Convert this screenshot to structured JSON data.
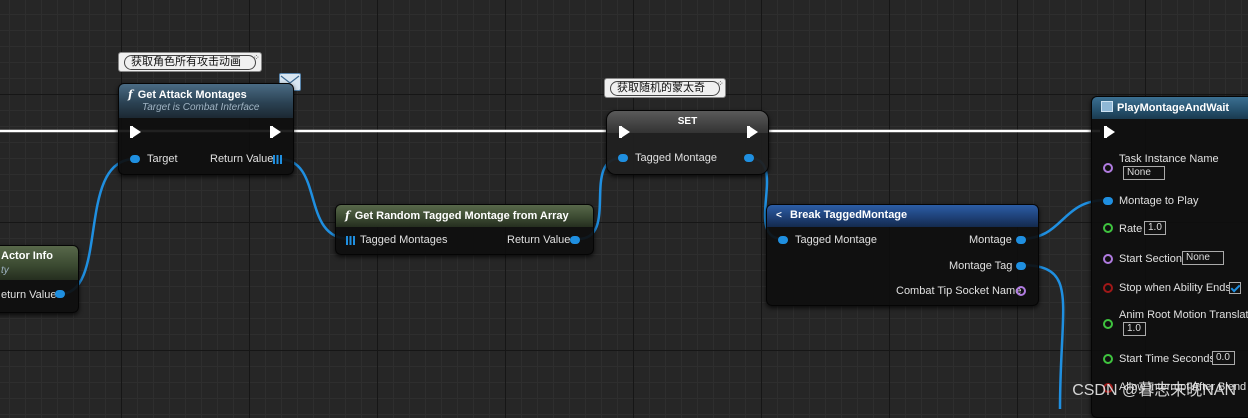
{
  "comments": {
    "get_attack": "获取角色所有攻击动画",
    "random": "获取随机的蒙太奇"
  },
  "nodes": {
    "actor_info": {
      "title": "Actor Info",
      "subtitle": "ty",
      "return_label": "eturn Value"
    },
    "get_attack": {
      "title": "Get Attack Montages",
      "subtitle": "Target is Combat Interface",
      "target_label": "Target",
      "return_label": "Return Value",
      "icon": "function-icon"
    },
    "random": {
      "title": "Get Random Tagged Montage from Array",
      "input_label": "Tagged Montages",
      "return_label": "Return Value",
      "icon": "function-icon"
    },
    "set": {
      "title": "SET",
      "pin_label": "Tagged Montage"
    },
    "break": {
      "title": "Break TaggedMontage",
      "input_label": "Tagged Montage",
      "out_montage": "Montage",
      "out_tag": "Montage Tag",
      "out_socket": "Combat Tip Socket Name",
      "icon": "break-struct-icon"
    },
    "play": {
      "title": "PlayMontageAndWait",
      "icon": "task-node-icon",
      "pins": {
        "task_instance_name": "Task Instance Name",
        "task_instance_value": "None",
        "montage_to_play": "Montage to Play",
        "rate": "Rate",
        "rate_value": "1.0",
        "start_section": "Start Section",
        "start_section_value": "None",
        "stop_when_ability_ends": "Stop when Ability Ends",
        "stop_when_ability_ends_checked": true,
        "anim_root_motion": "Anim Root Motion Translatio",
        "anim_root_motion_value": "1.0",
        "start_time_seconds": "Start Time Seconds",
        "start_time_value": "0.0",
        "allow_interrupt": "Allow Interrupt After Blend Out"
      }
    }
  },
  "watermark": "CSDN @暮志未晚NAN",
  "colors": {
    "exec_wire": "#ffffff",
    "object_wire": "#1f8fe0",
    "name_pin": "#b07be0",
    "float_pin": "#3fc43f",
    "bool_pin": "#a01818"
  }
}
